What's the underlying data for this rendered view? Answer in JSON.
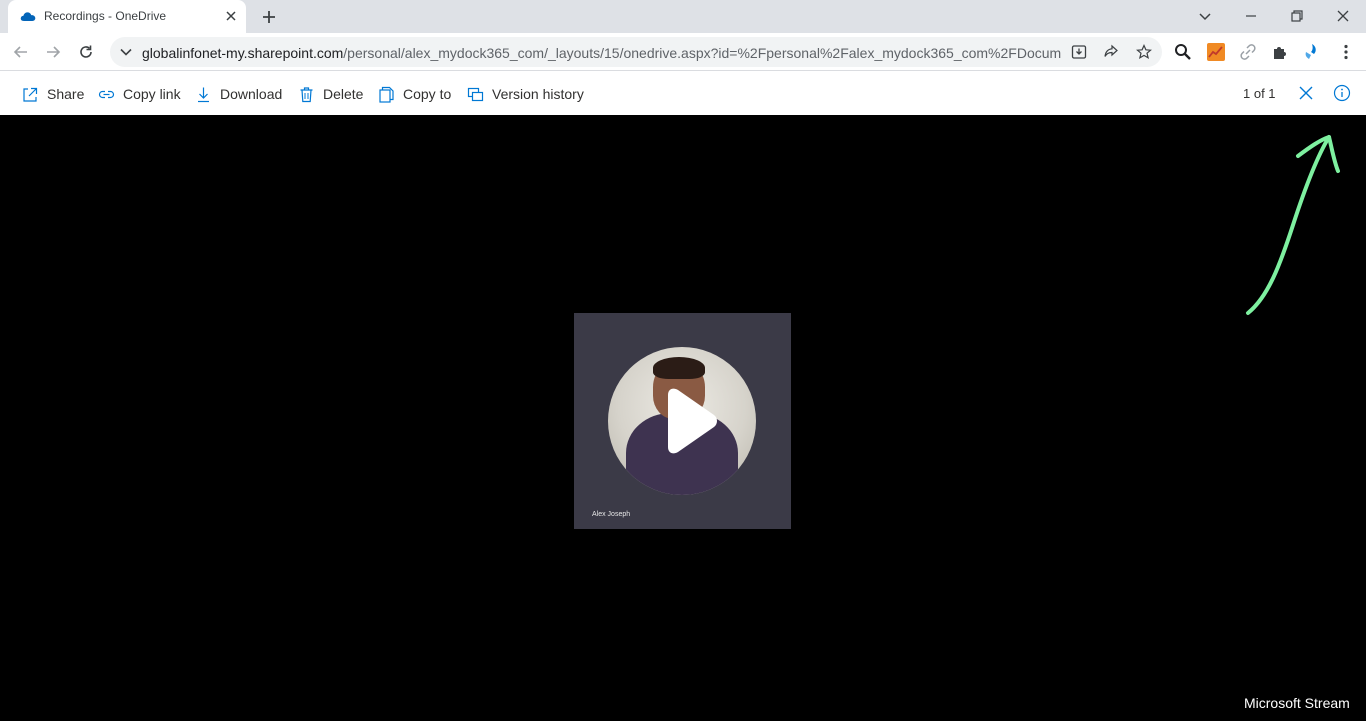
{
  "browser": {
    "tab_title": "Recordings - OneDrive",
    "url_host": "globalinfonet-my.sharepoint.com",
    "url_path": "/personal/alex_mydock365_com/_layouts/15/onedrive.aspx?id=%2Fpersonal%2Falex_mydock365_com%2FDocum..."
  },
  "commands": {
    "share": "Share",
    "copy_link": "Copy link",
    "download": "Download",
    "delete": "Delete",
    "copy_to": "Copy to",
    "version_history": "Version history",
    "counter": "1 of 1"
  },
  "viewer": {
    "thumbnail_name": "Alex Joseph",
    "brand": "Microsoft Stream"
  },
  "colors": {
    "accent": "#0078d4",
    "annotation": "#7ef0a0"
  }
}
